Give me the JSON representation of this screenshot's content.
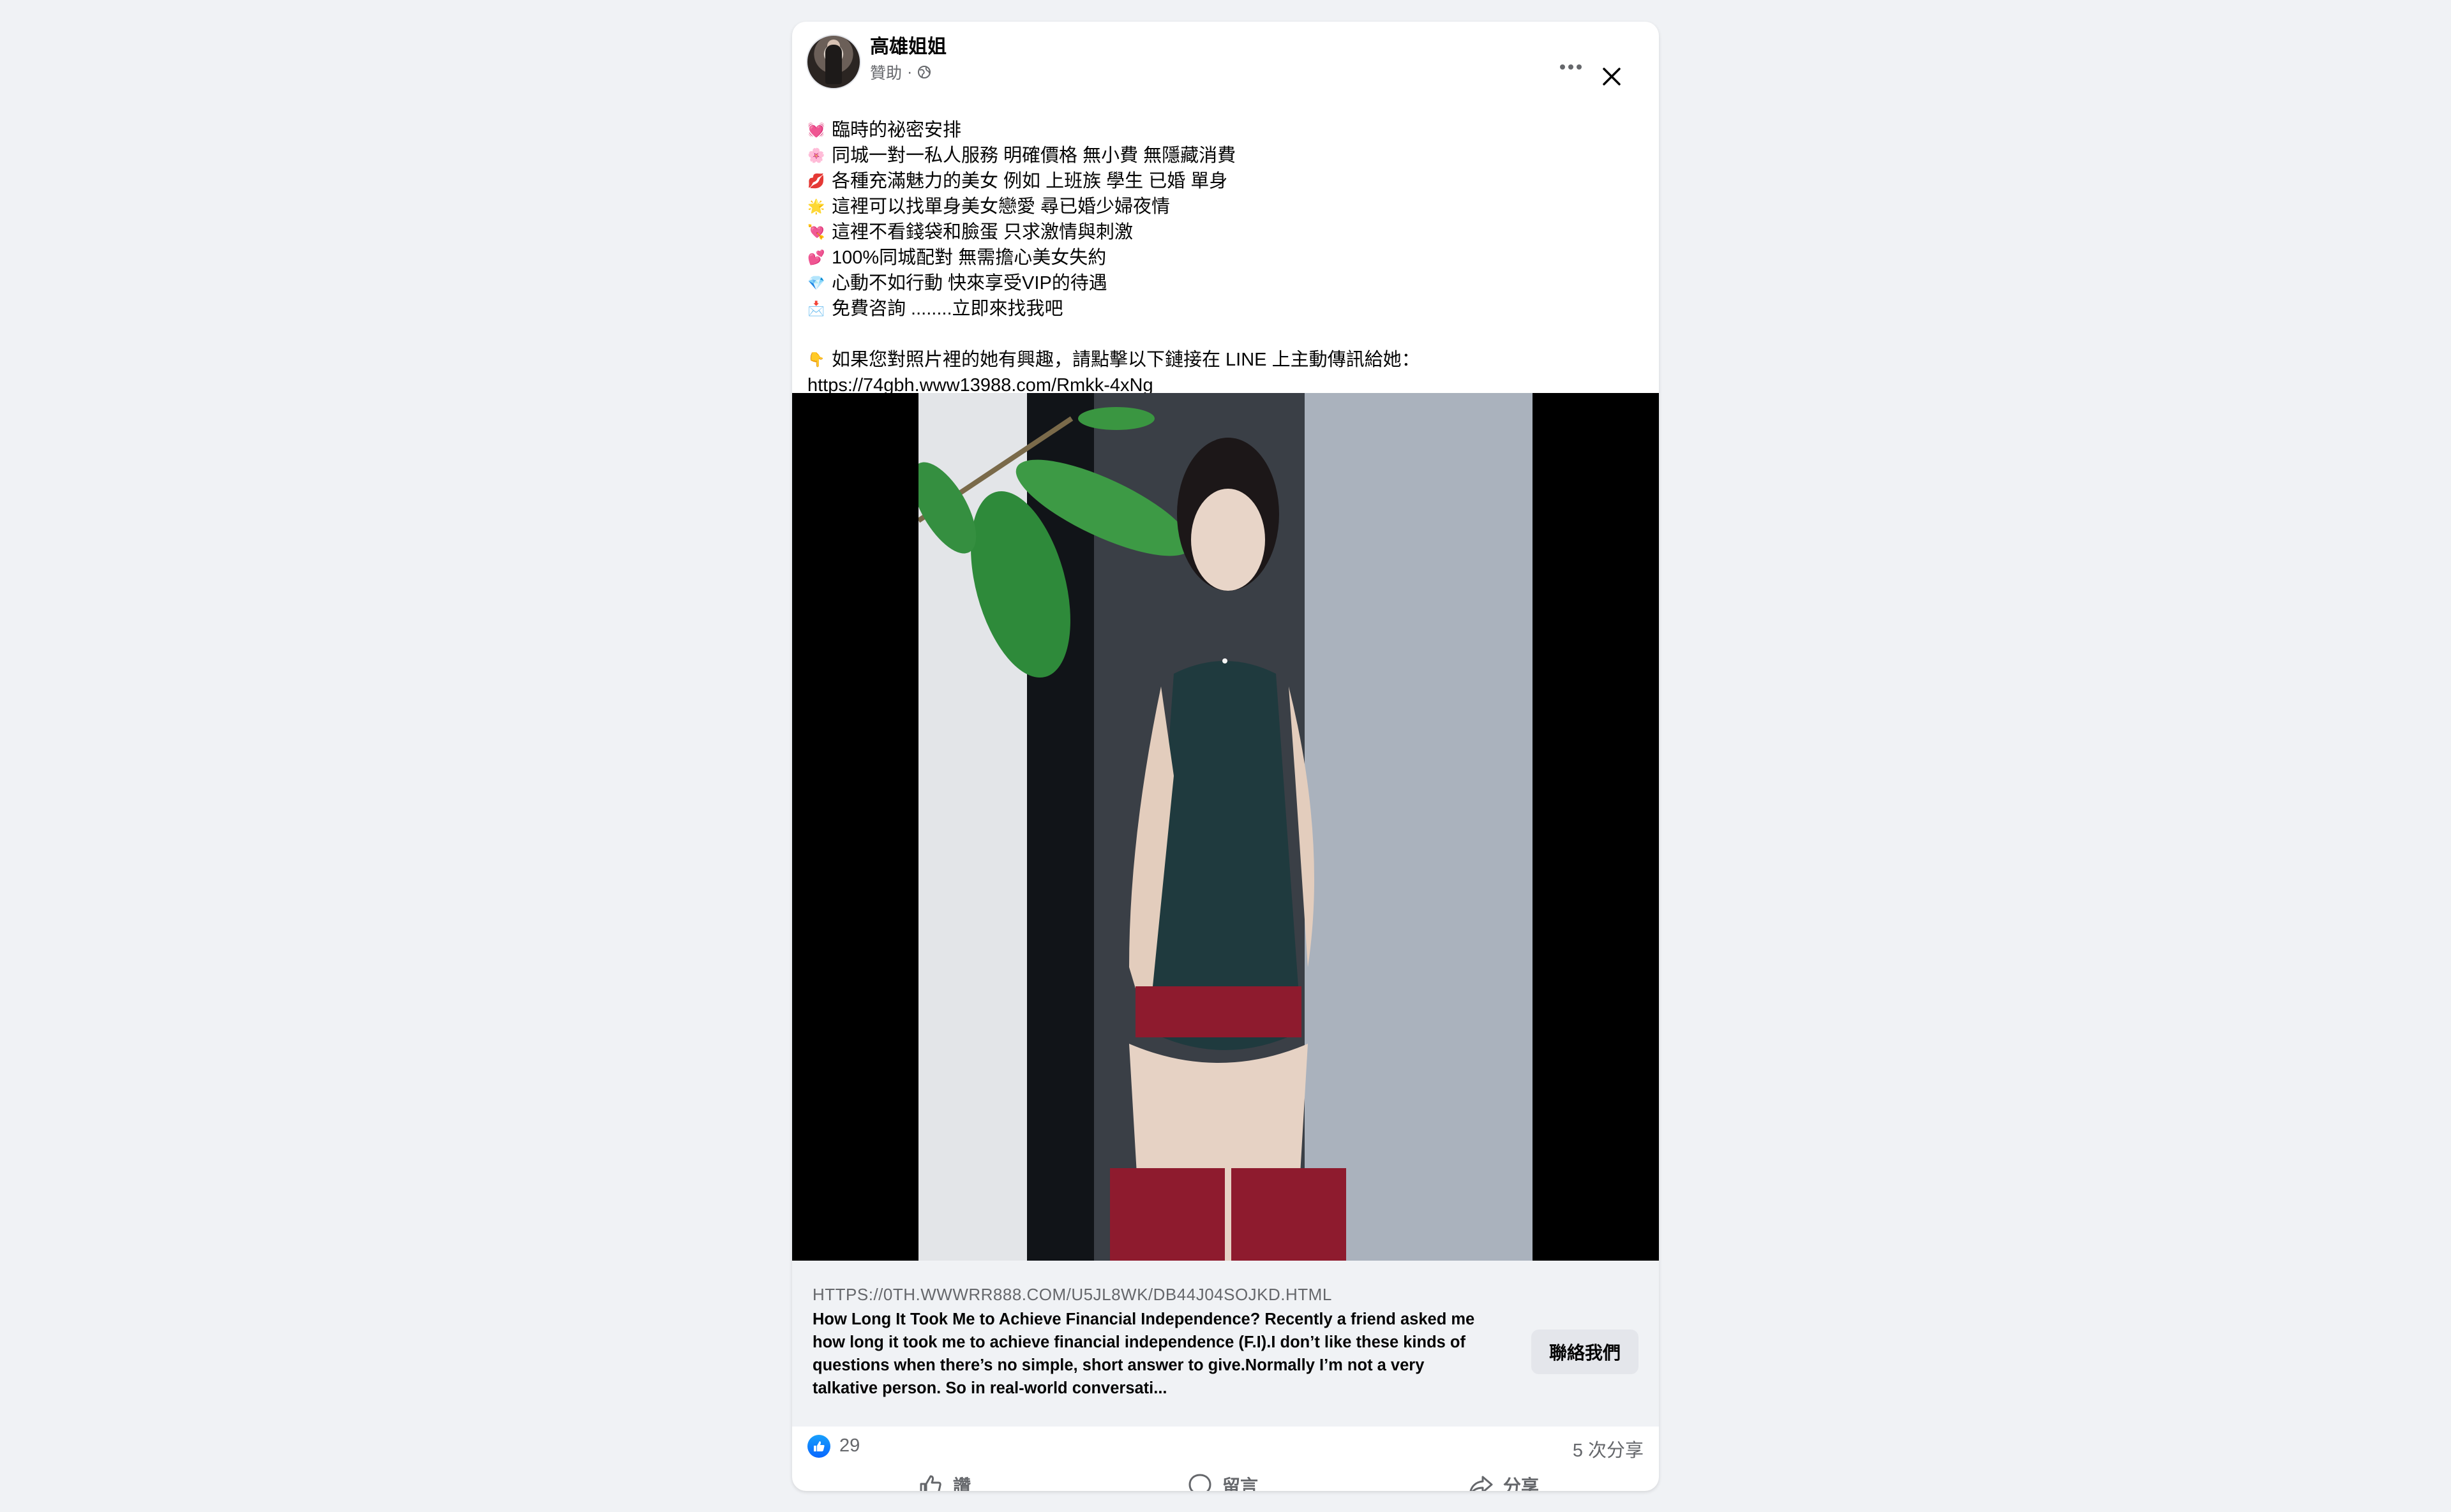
{
  "post": {
    "page_name": "高雄姐姐",
    "sponsored_label": "贊助",
    "meta_separator": "·",
    "lines": [
      {
        "emoji": "💓",
        "text": "臨時的祕密安排"
      },
      {
        "emoji": "🌸",
        "text": "同城一對一私人服務  明確價格 無小費 無隱藏消費"
      },
      {
        "emoji": "💋",
        "text": "各種充滿魅力的美女  例如 上班族  學生 已婚 單身"
      },
      {
        "emoji": "🌟",
        "text": "這裡可以找單身美女戀愛  尋已婚少婦夜情"
      },
      {
        "emoji": "💘",
        "text": "這裡不看錢袋和臉蛋  只求激情與刺激"
      },
      {
        "emoji": "💕",
        "text": "100%同城配對  無需擔心美女失約"
      },
      {
        "emoji": "💎",
        "text": "心動不如行動 快來享受VIP的待遇"
      },
      {
        "emoji": "📩",
        "text": "免費咨詢 ........立即來找我吧"
      }
    ],
    "cta_emoji": "👇",
    "cta_text": "如果您對照片裡的她有興趣，請點擊以下鏈接在 LINE 上主動傳訊給她：",
    "cta_link": "https://74gbh.www13988.com/Rmkk-4xNg"
  },
  "link_preview": {
    "domain": "HTTPS://0TH.WWWRR888.COM/U5JL8WK/DB44J04SOJKD.HTML",
    "description": "How Long It Took Me to Achieve Financial Independence? Recently a friend asked me how long it took me to achieve financial independence (F.I).I don’t like these kinds of questions when there’s no simple, short answer to give.Normally I’m not a very talkative person. So in real-world conversati...",
    "button_label": "聯絡我們"
  },
  "stats": {
    "reaction_count": "29",
    "share_count": "5 次分享"
  },
  "actions": {
    "like_label": "讚",
    "comment_label": "留言",
    "share_label": "分享"
  },
  "colors": {
    "background": "#f0f2f5",
    "card": "#ffffff",
    "secondary_text": "#65676b",
    "like_blue": "#0866ff"
  }
}
